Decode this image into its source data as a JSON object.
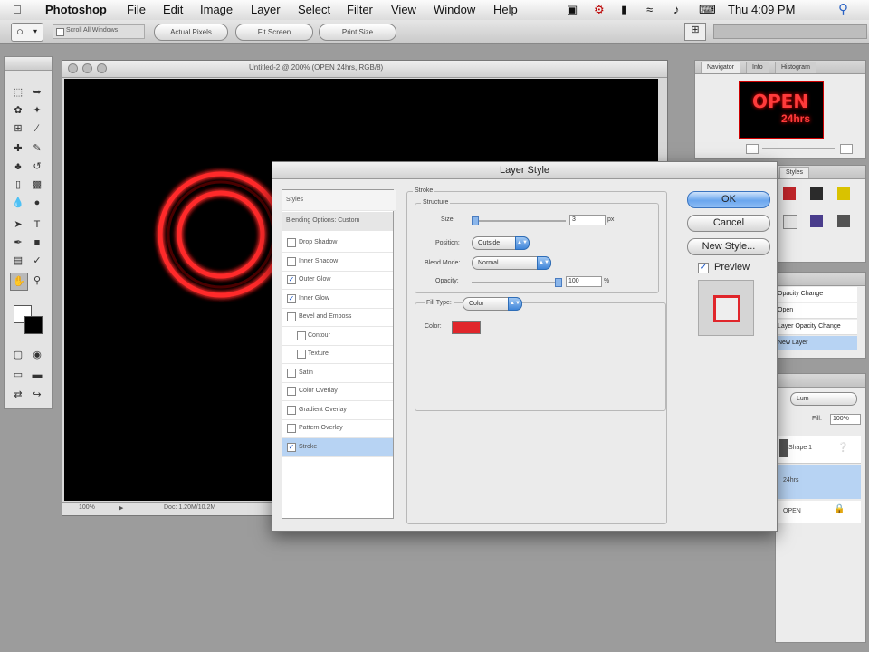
{
  "menubar": {
    "app": "Photoshop",
    "menus": [
      "File",
      "Edit",
      "Image",
      "Layer",
      "Select",
      "Filter",
      "View",
      "Window",
      "Help"
    ],
    "clock": "Thu 4:09 PM"
  },
  "options_bar": {
    "checkbox_label": "Scroll All Windows",
    "buttons": [
      "Actual Pixels",
      "Fit Screen",
      "Print Size"
    ]
  },
  "document": {
    "title": "Untitled-2 @ 200% (OPEN 24hrs, RGB/8)",
    "zoom": "100%",
    "status": "Doc: 1.20M/10.2M"
  },
  "navigator": {
    "tabs": [
      "Navigator",
      "Info",
      "Histogram"
    ],
    "thumb_text_1": "OPEN",
    "thumb_text_2": "24hrs"
  },
  "swatches": {
    "tab": "Styles"
  },
  "history": {
    "items": [
      "Opacity Change",
      "Open",
      "Layer Opacity Change",
      "New Layer"
    ]
  },
  "layers": {
    "blend": "Lum",
    "fill_label": "Fill:",
    "fill_value": "100%",
    "rows": [
      "Shape 1",
      "24hrs",
      "OPEN"
    ]
  },
  "dialog": {
    "title": "Layer Style",
    "list_header": "Styles",
    "blending": "Blending Options: Custom",
    "effects": [
      {
        "label": "Drop Shadow",
        "checked": false
      },
      {
        "label": "Inner Shadow",
        "checked": false
      },
      {
        "label": "Outer Glow",
        "checked": true
      },
      {
        "label": "Inner Glow",
        "checked": true
      },
      {
        "label": "Bevel and Emboss",
        "checked": false
      },
      {
        "label": "Contour",
        "checked": false
      },
      {
        "label": "Texture",
        "checked": false
      },
      {
        "label": "Satin",
        "checked": false
      },
      {
        "label": "Color Overlay",
        "checked": false
      },
      {
        "label": "Gradient Overlay",
        "checked": false
      },
      {
        "label": "Pattern Overlay",
        "checked": false
      },
      {
        "label": "Stroke",
        "checked": true,
        "selected": true
      }
    ],
    "section": "Stroke",
    "structure": "Structure",
    "size_label": "Size:",
    "size_value": "3",
    "size_unit": "px",
    "position_label": "Position:",
    "position_value": "Outside",
    "blend_label": "Blend Mode:",
    "blend_value": "Normal",
    "opacity_label": "Opacity:",
    "opacity_value": "100",
    "opacity_unit": "%",
    "filltype_label": "Fill Type:",
    "filltype_value": "Color",
    "color_label": "Color:",
    "stroke_color": "#e0262b",
    "ok": "OK",
    "cancel": "Cancel",
    "new_style": "New Style...",
    "preview_label": "Preview",
    "preview_checked": true
  }
}
